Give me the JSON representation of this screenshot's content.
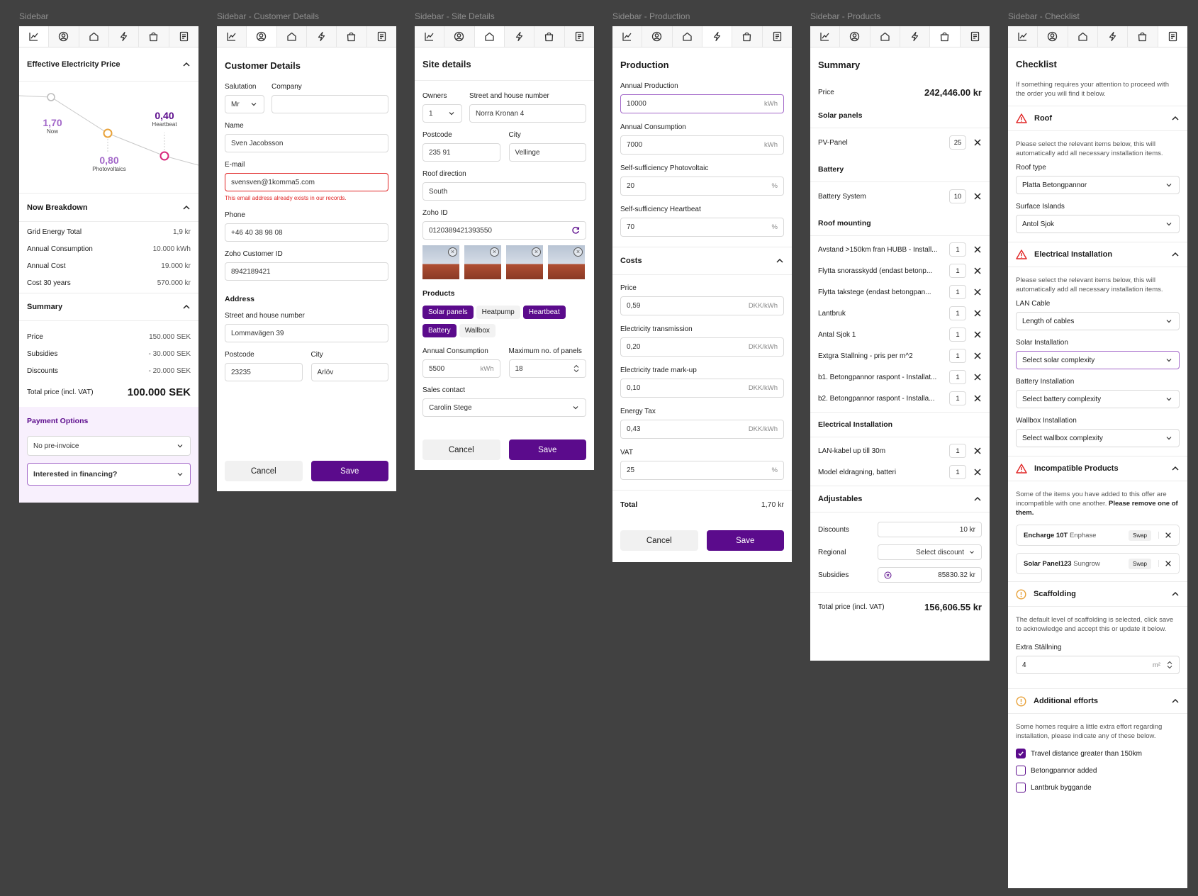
{
  "frames": {
    "f1": {
      "title": "Sidebar"
    },
    "f2": {
      "title": "Sidebar - Customer Details"
    },
    "f3": {
      "title": "Sidebar - Site Details"
    },
    "f4": {
      "title": "Sidebar - Production"
    },
    "f5": {
      "title": "Sidebar - Products"
    },
    "f6": {
      "title": "Sidebar - Checklist"
    }
  },
  "colors": {
    "accent": "#5b0b8c",
    "error": "#e02424",
    "warning": "#e8a23a",
    "pink": "#d8287c"
  },
  "tab_icons": [
    "chart-icon",
    "user-circle-icon",
    "house-icon",
    "lightning-icon",
    "bag-icon",
    "notes-icon"
  ],
  "sidebar": {
    "price_section": "Effective Electricity Price",
    "labels": {
      "now_val": "1,70",
      "now": "Now",
      "pv_val": "0,80",
      "pv": "Photovoltaics",
      "hb_val": "0,40",
      "hb": "Heartbeat"
    },
    "breakdown_title": "Now Breakdown",
    "breakdown": [
      {
        "k": "Grid Energy Total",
        "v": "1,9 kr"
      },
      {
        "k": "Annual Consumption",
        "v": "10.000 kWh"
      },
      {
        "k": "Annual Cost",
        "v": "19.000 kr"
      },
      {
        "k": "Cost 30 years",
        "v": "570.000 kr"
      }
    ],
    "summary_title": "Summary",
    "summary": [
      {
        "k": "Price",
        "v": "150.000 SEK"
      },
      {
        "k": "Subsidies",
        "v": "- 30.000 SEK"
      },
      {
        "k": "Discounts",
        "v": "- 20.000 SEK"
      }
    ],
    "total_label": "Total price (incl. VAT)",
    "total_value": "100.000 SEK",
    "payment_title": "Payment Options",
    "pre_invoice": "No pre-invoice",
    "financing": "Interested in financing?"
  },
  "customer": {
    "title": "Customer Details",
    "salutation_label": "Salutation",
    "salutation": "Mr",
    "company_label": "Company",
    "company": "",
    "name_label": "Name",
    "name": "Sven Jacobsson",
    "email_label": "E-mail",
    "email": "svensven@1komma5.com",
    "email_error": "This email address already exists in our records.",
    "phone_label": "Phone",
    "phone": "+46 40 38 98 08",
    "zoho_label": "Zoho Customer ID",
    "zoho": "8942189421",
    "address_title": "Address",
    "street_label": "Street and house number",
    "street": "Lommavägen 39",
    "postcode_label": "Postcode",
    "postcode": "23235",
    "city_label": "City",
    "city": "Arlöv",
    "cancel": "Cancel",
    "save": "Save"
  },
  "site": {
    "title": "Site details",
    "owners_label": "Owners",
    "owners": "1",
    "street_label": "Street and house number",
    "street": "Norra Kronan 4",
    "postcode_label": "Postcode",
    "postcode": "235 91",
    "city_label": "City",
    "city": "Vellinge",
    "roof_label": "Roof direction",
    "roof": "South",
    "zoho_label": "Zoho ID",
    "zoho": "0120389421393550",
    "products_title": "Products",
    "products": [
      {
        "label": "Solar panels",
        "on": true
      },
      {
        "label": "Heatpump",
        "on": false
      },
      {
        "label": "Heartbeat",
        "on": true
      },
      {
        "label": "Battery",
        "on": true
      },
      {
        "label": "Wallbox",
        "on": false
      }
    ],
    "consumption_label": "Annual Consumption",
    "consumption": "5500",
    "consumption_unit": "kWh",
    "panels_label": "Maximum no. of panels",
    "panels": "18",
    "sales_label": "Sales contact",
    "sales": "Carolin Stege",
    "cancel": "Cancel",
    "save": "Save"
  },
  "production": {
    "title": "Production",
    "fields": [
      {
        "label": "Annual Production",
        "value": "10000",
        "unit": "kWh"
      },
      {
        "label": "Annual Consumption",
        "value": "7000",
        "unit": "kWh"
      },
      {
        "label": "Self-sufficiency Photovoltaic",
        "value": "20",
        "unit": "%"
      },
      {
        "label": "Self-sufficiency Heartbeat",
        "value": "70",
        "unit": "%"
      }
    ],
    "costs_title": "Costs",
    "costs": [
      {
        "label": "Price",
        "value": "0,59",
        "unit": "DKK/kWh"
      },
      {
        "label": "Electricity transmission",
        "value": "0,20",
        "unit": "DKK/kWh"
      },
      {
        "label": "Electricity trade mark-up",
        "value": "0,10",
        "unit": "DKK/kWh"
      },
      {
        "label": "Energy Tax",
        "value": "0,43",
        "unit": "DKK/kWh"
      },
      {
        "label": "VAT",
        "value": "25",
        "unit": "%"
      }
    ],
    "total_label": "Total",
    "total": "1,70 kr",
    "cancel": "Cancel",
    "save": "Save"
  },
  "products": {
    "title": "Summary",
    "price_label": "Price",
    "price": "242,446.00 kr",
    "solar_title": "Solar panels",
    "solar": [
      {
        "name": "PV-Panel",
        "qty": "25"
      }
    ],
    "battery_title": "Battery",
    "battery": [
      {
        "name": "Battery System",
        "qty": "10"
      }
    ],
    "roof_title": "Roof mounting",
    "roof": [
      {
        "name": "Avstand >150km fran HUBB - Install...",
        "qty": "1"
      },
      {
        "name": "Flytta snorasskydd (endast betonp...",
        "qty": "1"
      },
      {
        "name": "Flytta takstege (endast betongpan...",
        "qty": "1"
      },
      {
        "name": "Lantbruk",
        "qty": "1"
      },
      {
        "name": "Antal Sjok 1",
        "qty": "1"
      },
      {
        "name": "Extgra Stallning - pris per m^2",
        "qty": "1"
      },
      {
        "name": "b1. Betongpannor raspont - Installat...",
        "qty": "1"
      },
      {
        "name": "b2. Betongpannor raspont - Installa...",
        "qty": "1"
      }
    ],
    "elec_title": "Electrical Installation",
    "elec": [
      {
        "name": "LAN-kabel up till 30m",
        "qty": "1"
      },
      {
        "name": "Model eldragning, batteri",
        "qty": "1"
      }
    ],
    "adj_title": "Adjustables",
    "discounts_label": "Discounts",
    "discounts": "10 kr",
    "regional_label": "Regional",
    "regional": "Select discount",
    "subsidies_label": "Subsidies",
    "subsidies": "85830.32 kr",
    "total_label": "Total price (incl. VAT)",
    "total": "156,606.55 kr"
  },
  "checklist": {
    "title": "Checklist",
    "intro": "If something requires your attention to proceed with the order you will find it below.",
    "roof_title": "Roof",
    "roof_desc": "Please select the relevant items below, this will automatically add all necessary installation items.",
    "roof_type_label": "Roof type",
    "roof_type": "Platta Betongpannor",
    "islands_label": "Surface Islands",
    "islands": "Antol Sjok",
    "elec_title": "Electrical Installation",
    "elec_desc": "Please select the relevant items below, this will automatically add all necessary installation items.",
    "lan_label": "LAN Cable",
    "lan": "Length of cables",
    "solar_label": "Solar Installation",
    "solar": "Select solar complexity",
    "battery_label": "Battery Installation",
    "battery": "Select battery complexity",
    "wallbox_label": "Wallbox Installation",
    "wallbox": "Select wallbox complexity",
    "incompat_title": "Incompatible Products",
    "incompat_desc": "Some of the items you have added to this offer are incompatible with one another.",
    "incompat_bold": "Please remove one of them.",
    "incompat": [
      {
        "name": "Encharge 10T",
        "brand": "Enphase",
        "swap": "Swap"
      },
      {
        "name": "Solar Panel123",
        "brand": "Sungrow",
        "swap": "Swap"
      }
    ],
    "scaffold_title": "Scaffolding",
    "scaffold_desc": "The default level of scaffolding is selected, click save to acknowledge and accept this or update it below.",
    "extra_label": "Extra Ställning",
    "extra": "4",
    "extra_unit": "m²",
    "efforts_title": "Additional efforts",
    "efforts_desc": "Some homes require a little extra effort regarding installation, please indicate any of these below.",
    "efforts": [
      {
        "label": "Travel distance greater than 150km",
        "checked": true
      },
      {
        "label": "Betongpannor added",
        "checked": false
      },
      {
        "label": "Lantbruk byggande",
        "checked": false
      }
    ]
  }
}
